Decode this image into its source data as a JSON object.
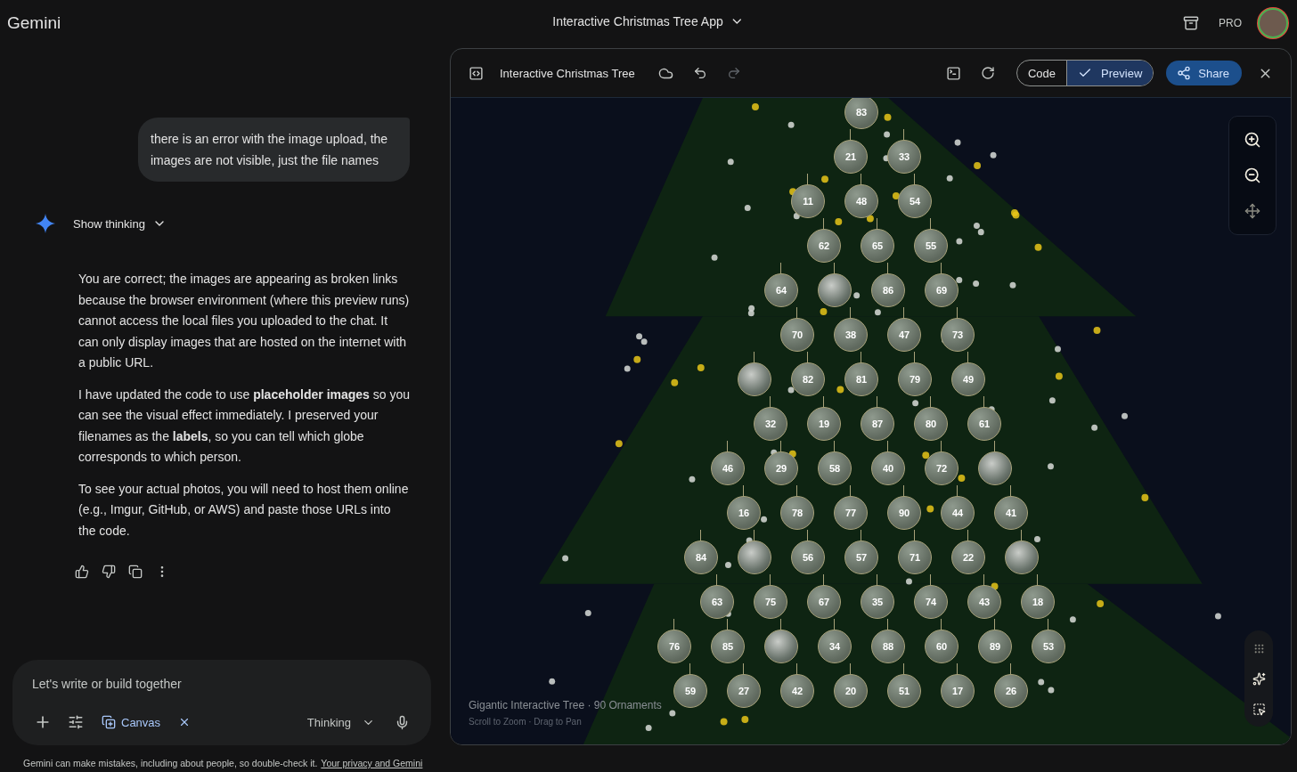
{
  "app": {
    "name": "Gemini",
    "conversation_title": "Interactive Christmas Tree App",
    "plan_badge": "PRO"
  },
  "chat": {
    "user_message": "there is an error with the image upload, the images are not visible, just the file names",
    "thinking_toggle": {
      "label": "Show thinking",
      "expanded": false
    },
    "response_paragraphs": [
      "You are correct; the images are appearing as broken links because the browser environment (where this preview runs) cannot access the local files you uploaded to the chat. It can only display images that are hosted on the internet with a public URL.",
      "I have updated the code to use **placeholder images** so you can see the visual effect immediately. I preserved your filenames as the **labels**, so you can tell which globe corresponds to which person.",
      "To see your actual photos, you will need to host them online (e.g., Imgur, GitHub, or AWS) and paste those URLs into the code."
    ],
    "input": {
      "placeholder": "Let's write or build together",
      "tool_chip": "Canvas",
      "mode": "Thinking"
    },
    "disclaimer": "Gemini can make mistakes, including about people, so double-check it.",
    "privacy_link": "Your privacy and Gemini"
  },
  "canvas": {
    "title": "Interactive Christmas Tree",
    "redo_disabled": true,
    "view_tabs": [
      {
        "label": "Code",
        "selected": false
      },
      {
        "label": "Preview",
        "selected": true
      }
    ],
    "share_label": "Share",
    "preview": {
      "caption": "Gigantic Interactive Tree · 90 Ornaments",
      "hint": "Scroll to Zoom · Drag to Pan",
      "ornaments": [
        {
          "kind": "number",
          "label": "83"
        },
        {
          "kind": "number",
          "label": "21"
        },
        {
          "kind": "number",
          "label": "33"
        },
        {
          "kind": "number",
          "label": "11"
        },
        {
          "kind": "number",
          "label": "48"
        },
        {
          "kind": "number",
          "label": "54"
        },
        {
          "kind": "number",
          "label": "62"
        },
        {
          "kind": "number",
          "label": "65"
        },
        {
          "kind": "number",
          "label": "55"
        },
        {
          "kind": "number",
          "label": "64"
        },
        {
          "kind": "photo"
        },
        {
          "kind": "number",
          "label": "86"
        },
        {
          "kind": "number",
          "label": "69"
        },
        {
          "kind": "number",
          "label": "70"
        },
        {
          "kind": "number",
          "label": "38"
        },
        {
          "kind": "number",
          "label": "47"
        },
        {
          "kind": "number",
          "label": "73"
        },
        {
          "kind": "photo"
        },
        {
          "kind": "number",
          "label": "82"
        },
        {
          "kind": "number",
          "label": "81"
        },
        {
          "kind": "number",
          "label": "79"
        },
        {
          "kind": "number",
          "label": "49"
        },
        {
          "kind": "number",
          "label": "32"
        },
        {
          "kind": "number",
          "label": "19"
        },
        {
          "kind": "number",
          "label": "87"
        },
        {
          "kind": "number",
          "label": "80"
        },
        {
          "kind": "number",
          "label": "61"
        },
        {
          "kind": "number",
          "label": "46"
        },
        {
          "kind": "number",
          "label": "29"
        },
        {
          "kind": "number",
          "label": "58"
        },
        {
          "kind": "number",
          "label": "40"
        },
        {
          "kind": "number",
          "label": "72"
        },
        {
          "kind": "photo"
        },
        {
          "kind": "number",
          "label": "16"
        },
        {
          "kind": "number",
          "label": "78"
        },
        {
          "kind": "number",
          "label": "77"
        },
        {
          "kind": "number",
          "label": "90"
        },
        {
          "kind": "number",
          "label": "44"
        },
        {
          "kind": "number",
          "label": "41"
        },
        {
          "kind": "number",
          "label": "84"
        },
        {
          "kind": "photo"
        },
        {
          "kind": "number",
          "label": "56"
        },
        {
          "kind": "number",
          "label": "57"
        },
        {
          "kind": "number",
          "label": "71"
        },
        {
          "kind": "number",
          "label": "22"
        },
        {
          "kind": "photo"
        },
        {
          "kind": "number",
          "label": "63"
        },
        {
          "kind": "number",
          "label": "75"
        },
        {
          "kind": "number",
          "label": "67"
        },
        {
          "kind": "number",
          "label": "35"
        },
        {
          "kind": "number",
          "label": "74"
        },
        {
          "kind": "number",
          "label": "43"
        },
        {
          "kind": "number",
          "label": "18"
        },
        {
          "kind": "number",
          "label": "76"
        },
        {
          "kind": "number",
          "label": "85"
        },
        {
          "kind": "photo"
        },
        {
          "kind": "number",
          "label": "34"
        },
        {
          "kind": "number",
          "label": "88"
        },
        {
          "kind": "number",
          "label": "60"
        },
        {
          "kind": "number",
          "label": "89"
        },
        {
          "kind": "number",
          "label": "53"
        },
        {
          "kind": "number",
          "label": "59"
        },
        {
          "kind": "number",
          "label": "27"
        },
        {
          "kind": "number",
          "label": "42"
        },
        {
          "kind": "number",
          "label": "20"
        },
        {
          "kind": "number",
          "label": "51"
        },
        {
          "kind": "number",
          "label": "17"
        },
        {
          "kind": "number",
          "label": "26"
        }
      ]
    }
  }
}
